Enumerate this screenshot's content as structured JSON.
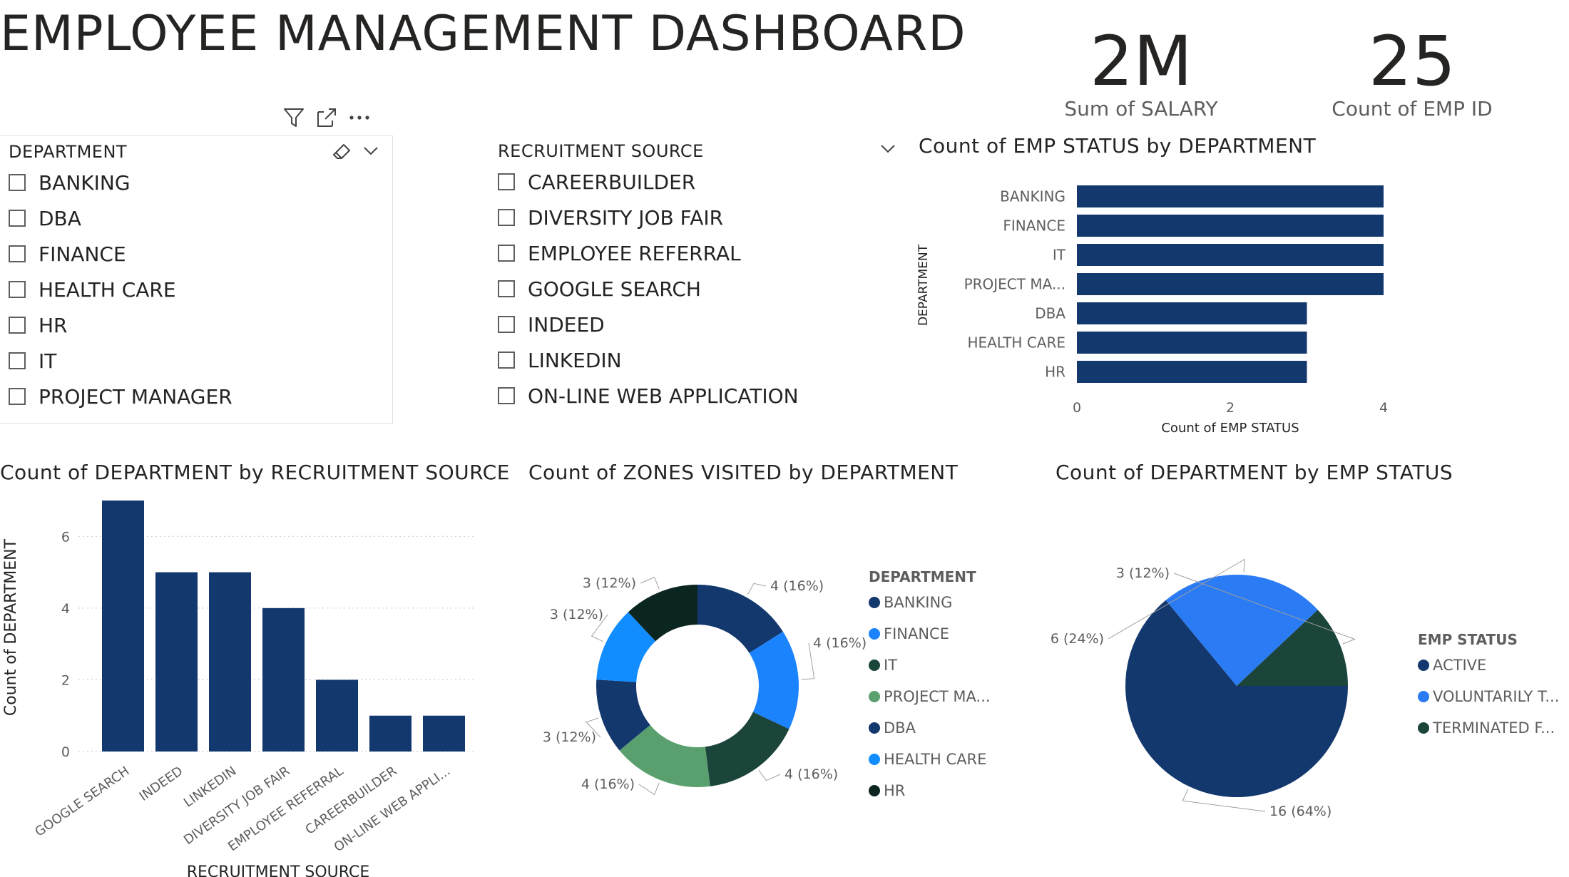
{
  "title": "EMPLOYEE MANAGEMENT DASHBOARD",
  "cards": [
    {
      "value": "2M",
      "label": "Sum of SALARY"
    },
    {
      "value": "25",
      "label": "Count of EMP ID"
    }
  ],
  "slicers": {
    "department": {
      "header": "DEPARTMENT",
      "items": [
        "BANKING",
        "DBA",
        "FINANCE",
        "HEALTH CARE",
        "HR",
        "IT",
        "PROJECT MANAGER"
      ]
    },
    "recruitment": {
      "header": "RECRUITMENT SOURCE",
      "items": [
        "CAREERBUILDER",
        "DIVERSITY JOB FAIR",
        "EMPLOYEE REFERRAL",
        "GOOGLE SEARCH",
        "INDEED",
        "LINKEDIN",
        "ON-LINE WEB APPLICATION"
      ]
    }
  },
  "icons": {
    "filter": "filter-icon",
    "focus": "focus-mode-icon",
    "more": "more-options-icon",
    "eraser": "eraser-icon",
    "chevron": "chevron-down-icon"
  },
  "colors": {
    "dark_blue": "#12386E",
    "bright_blue": "#1C83FF",
    "teal_dark": "#1B443B",
    "green": "#5AA06E",
    "sky_blue": "#118DFF",
    "near_black": "#0B2521",
    "pie_blue": "#2B7BF4"
  },
  "chart_data": [
    {
      "id": "empstatus_by_dept",
      "type": "bar",
      "orientation": "horizontal",
      "title": "Count of EMP STATUS by DEPARTMENT",
      "categories": [
        "BANKING",
        "FINANCE",
        "IT",
        "PROJECT MA...",
        "DBA",
        "HEALTH CARE",
        "HR"
      ],
      "values": [
        4,
        4,
        4,
        4,
        3,
        3,
        3
      ],
      "xlabel": "Count of EMP STATUS",
      "ylabel": "DEPARTMENT",
      "xlim": [
        0,
        4
      ],
      "ticks": [
        "0",
        "2",
        "4"
      ]
    },
    {
      "id": "dept_by_recruitment",
      "type": "bar",
      "title": "Count of DEPARTMENT by RECRUITMENT SOURCE",
      "categories": [
        "GOOGLE SEARCH",
        "INDEED",
        "LINKEDIN",
        "DIVERSITY JOB FAIR",
        "EMPLOYEE REFERRAL",
        "CAREERBUILDER",
        "ON-LINE WEB APPLI..."
      ],
      "values": [
        7,
        5,
        5,
        4,
        2,
        1,
        1
      ],
      "xlabel": "RECRUITMENT SOURCE",
      "ylabel": "Count of DEPARTMENT",
      "ylim": [
        0,
        7
      ],
      "ticks": [
        "0",
        "2",
        "4",
        "6"
      ],
      "grid": true
    },
    {
      "id": "zones_by_dept",
      "type": "pie",
      "style": "donut",
      "title": "Count of ZONES VISITED by DEPARTMENT",
      "legend_title": "DEPARTMENT",
      "legend_position": "right",
      "legend": [
        "BANKING",
        "FINANCE",
        "IT",
        "PROJECT MA...",
        "DBA",
        "HEALTH CARE",
        "HR"
      ],
      "slices": [
        {
          "name": "BANKING",
          "value": 4,
          "label": "4 (16%)"
        },
        {
          "name": "FINANCE",
          "value": 4,
          "label": "4 (16%)"
        },
        {
          "name": "IT",
          "value": 4,
          "label": "4 (16%)"
        },
        {
          "name": "PROJECT MA...",
          "value": 4,
          "label": "4 (16%)"
        },
        {
          "name": "DBA",
          "value": 3,
          "label": "3 (12%)"
        },
        {
          "name": "HEALTH CARE",
          "value": 3,
          "label": "3 (12%)"
        },
        {
          "name": "HR",
          "value": 3,
          "label": "3 (12%)"
        }
      ]
    },
    {
      "id": "dept_by_empstatus",
      "type": "pie",
      "title": "Count of DEPARTMENT by EMP STATUS",
      "legend_title": "EMP STATUS",
      "legend_position": "right",
      "legend": [
        "ACTIVE",
        "VOLUNTARILY T...",
        "TERMINATED F..."
      ],
      "slices": [
        {
          "name": "ACTIVE",
          "value": 16,
          "label": "16 (64%)"
        },
        {
          "name": "VOLUNTARILY T...",
          "value": 6,
          "label": "6 (24%)"
        },
        {
          "name": "TERMINATED F...",
          "value": 3,
          "label": "3 (12%)"
        }
      ]
    }
  ]
}
